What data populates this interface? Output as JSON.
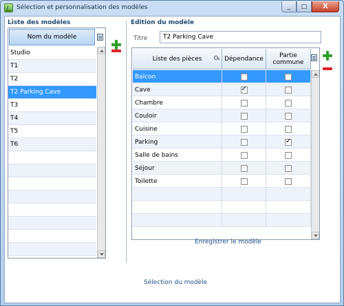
{
  "window": {
    "title": "Sélection et personnalisation des modèles",
    "icon": "app-edit-icon",
    "controls": {
      "minimize": "_",
      "maximize": "□",
      "close": "X"
    }
  },
  "left": {
    "section_title": "Liste des modèles",
    "column_header": "Nom du modèle",
    "items": [
      {
        "label": "Studio",
        "selected": false
      },
      {
        "label": "T1",
        "selected": false
      },
      {
        "label": "T2",
        "selected": false
      },
      {
        "label": "T2 Parking Cave",
        "selected": true
      },
      {
        "label": "T3",
        "selected": false
      },
      {
        "label": "T4",
        "selected": false
      },
      {
        "label": "T5",
        "selected": false
      },
      {
        "label": "T6",
        "selected": false
      },
      {
        "label": "",
        "selected": false
      },
      {
        "label": "",
        "selected": false
      },
      {
        "label": "",
        "selected": false
      },
      {
        "label": "",
        "selected": false
      },
      {
        "label": "",
        "selected": false
      },
      {
        "label": "",
        "selected": false
      },
      {
        "label": "",
        "selected": false
      },
      {
        "label": "",
        "selected": false
      }
    ]
  },
  "right": {
    "section_title": "Edition du modèle",
    "titre_label": "Titre",
    "titre_value": "T2 Parking Cave",
    "columns": {
      "pieces": "Liste des pièces",
      "dependance": "Dépendance",
      "partie_commune": "Partie commune"
    },
    "rows": [
      {
        "piece": "Balcon",
        "dependance": false,
        "commune": false,
        "selected": true
      },
      {
        "piece": "Cave",
        "dependance": true,
        "commune": false,
        "selected": false
      },
      {
        "piece": "Chambre",
        "dependance": false,
        "commune": false,
        "selected": false
      },
      {
        "piece": "Couloir",
        "dependance": false,
        "commune": false,
        "selected": false
      },
      {
        "piece": "Cuisine",
        "dependance": false,
        "commune": false,
        "selected": false
      },
      {
        "piece": "Parking",
        "dependance": false,
        "commune": true,
        "selected": false
      },
      {
        "piece": "Salle de bains",
        "dependance": false,
        "commune": false,
        "selected": false
      },
      {
        "piece": "Séjour",
        "dependance": false,
        "commune": false,
        "selected": false
      },
      {
        "piece": "Toilette",
        "dependance": false,
        "commune": false,
        "selected": false
      },
      {
        "piece": "",
        "empty": true
      },
      {
        "piece": "",
        "empty": true
      },
      {
        "piece": "",
        "empty": true
      }
    ],
    "save_label": "Enregistrer le modèle"
  },
  "footer": {
    "select_label": "Sélection du modèle"
  },
  "colors": {
    "selection": "#3399ff",
    "add": "#2ea028",
    "remove": "#e0202a",
    "link": "#1f4f86"
  }
}
